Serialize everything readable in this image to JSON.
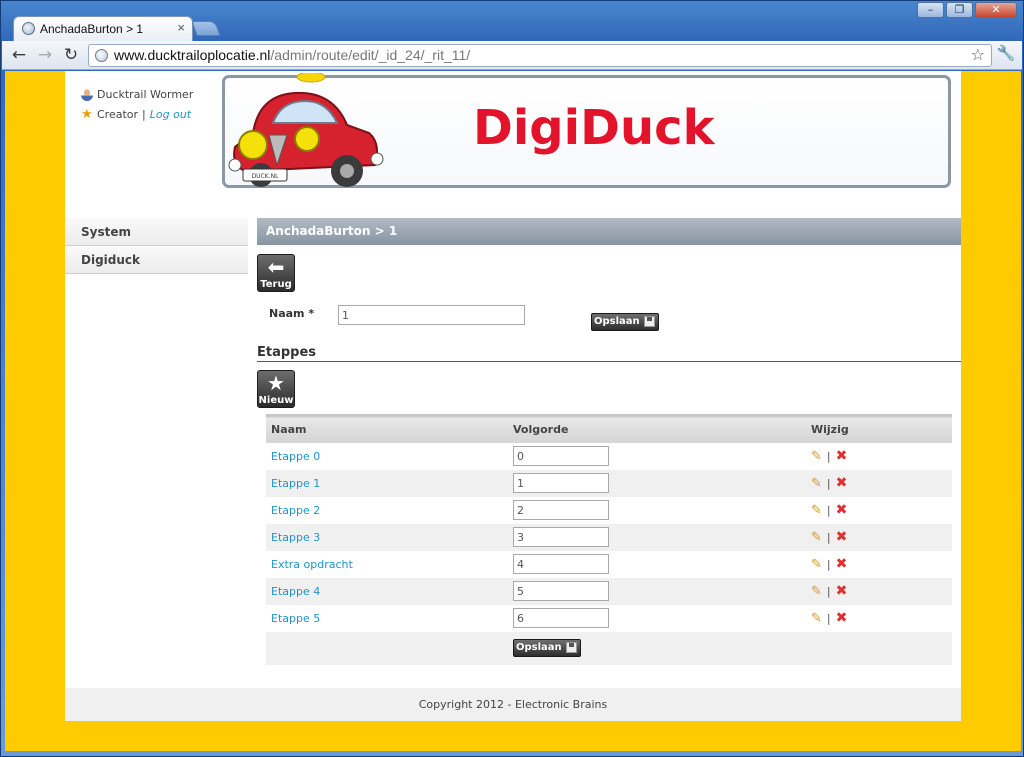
{
  "browser": {
    "tab_title": "AnchadaBurton > 1",
    "close_glyph": "×",
    "url_host": "www.ducktrailoplocatie.nl",
    "url_path": "/admin/route/edit/_id_24/_rit_11/",
    "window_buttons": [
      "–",
      "❐",
      "✕"
    ],
    "back_glyph": "←",
    "forward_glyph": "→",
    "reload_glyph": "↻",
    "star_glyph": "☆",
    "wrench_glyph": "🔧"
  },
  "header": {
    "user_name": "Ducktrail Wormer",
    "role": "Creator",
    "separator": "|",
    "logout_label": "Log out",
    "brand": "DigiDuck",
    "logo_plate": "DUCK.NL"
  },
  "sidebar": {
    "items": [
      {
        "label": "System"
      },
      {
        "label": "Digiduck"
      }
    ]
  },
  "main": {
    "breadcrumb": "AnchadaBurton > 1",
    "back_label": "Terug",
    "naam_label": "Naam *",
    "naam_value": "1",
    "save_label": "Opslaan",
    "section_title": "Etappes",
    "new_label": "Nieuw"
  },
  "table": {
    "headers": [
      "Naam",
      "Volgorde",
      "Wijzig"
    ],
    "rows": [
      {
        "name": "Etappe 0",
        "order": "0"
      },
      {
        "name": "Etappe 1",
        "order": "1"
      },
      {
        "name": "Etappe 2",
        "order": "2"
      },
      {
        "name": "Etappe 3",
        "order": "3"
      },
      {
        "name": "Extra opdracht",
        "order": "4"
      },
      {
        "name": "Etappe 4",
        "order": "5"
      },
      {
        "name": "Etappe 5",
        "order": "6"
      }
    ],
    "action_separator": "|",
    "save_label": "Opslaan"
  },
  "footer": {
    "text": "Copyright 2012 - Electronic Brains"
  },
  "colors": {
    "page_background": "#fecb00",
    "brand": "#e2132a",
    "link": "#1f95c6",
    "breadcrumb_bar": "#8894a2"
  },
  "icons": {
    "user": "person-icon",
    "role": "star-icon",
    "back": "arrow-left-icon",
    "new": "star-plus-icon",
    "edit": "pencil-icon",
    "delete": "delete-x-icon",
    "save": "floppy-disk-icon"
  }
}
